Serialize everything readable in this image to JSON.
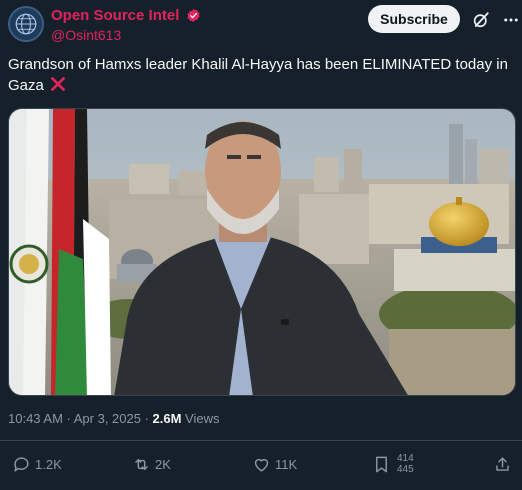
{
  "post": {
    "author": {
      "display_name": "Open Source Intel",
      "handle": "@Osint613",
      "verified": true,
      "avatar_icon": "globe-icon"
    },
    "subscribe_label": "Subscribe",
    "text": "Grandson of Hamxs leader Khalil Al-Hayya has been ELIMINATED today in Gaza",
    "emoji": "cross-mark-icon",
    "timestamp": "10:43 AM · Apr 3, 2025 · ",
    "views_count": "2.6M",
    "views_label": " Views"
  },
  "actions": {
    "replies": "1.2K",
    "reposts": "2K",
    "likes": "11K",
    "bookmarks_top": "414",
    "bookmarks_bottom": "445"
  },
  "colors": {
    "background": "#15202b",
    "author_accent": "#e0245e",
    "muted": "#8b98a5",
    "divider": "#38444d"
  }
}
